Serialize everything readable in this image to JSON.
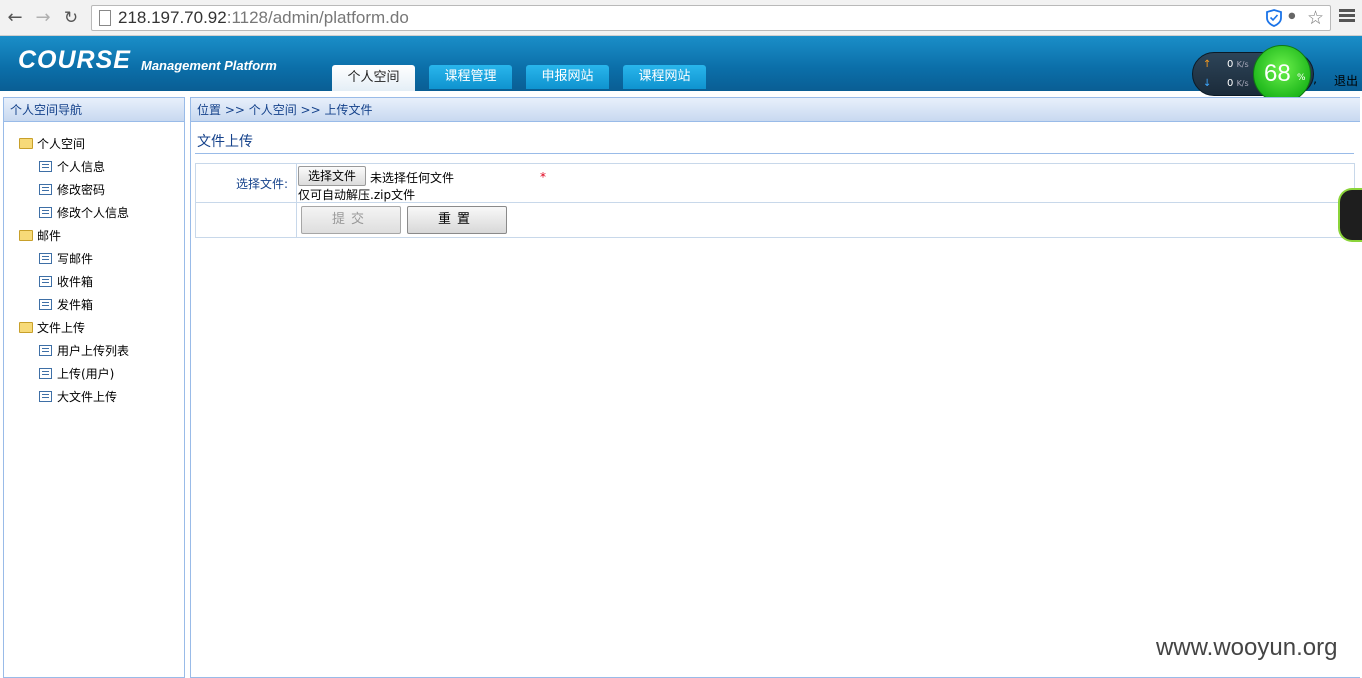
{
  "browser": {
    "url_host": "218.197.70.92",
    "url_path": ":1128/admin/platform.do"
  },
  "header": {
    "logo_main": "COURSE",
    "logo_sub": "Management Platform",
    "tabs": [
      {
        "label": "个人空间",
        "active": true
      },
      {
        "label": "课程管理",
        "active": false
      },
      {
        "label": "申报网站",
        "active": false
      },
      {
        "label": "课程网站",
        "active": false
      }
    ],
    "user_fragment": "y,",
    "logout_label": "退出"
  },
  "speed_widget": {
    "upload": "0",
    "upload_unit": "K/s",
    "download": "0",
    "download_unit": "K/s",
    "percent": "68",
    "percent_sign": "%"
  },
  "sidebar": {
    "title": "个人空间导航",
    "folders": [
      {
        "label": "个人空间",
        "items": [
          "个人信息",
          "修改密码",
          "修改个人信息"
        ]
      },
      {
        "label": "邮件",
        "items": [
          "写邮件",
          "收件箱",
          "发件箱"
        ]
      },
      {
        "label": "文件上传",
        "items": [
          "用户上传列表",
          "上传(用户)",
          "大文件上传"
        ]
      }
    ]
  },
  "main": {
    "breadcrumb": "位置 >> 个人空间 >> 上传文件",
    "title": "文件上传",
    "form": {
      "file_label": "选择文件:",
      "file_button": "选择文件",
      "file_status": "未选择任何文件",
      "required_mark": "*",
      "hint": "仅可自动解压.zip文件",
      "submit_label": "提交",
      "reset_label": "重置"
    }
  },
  "watermark": "www.wooyun.org",
  "colors": {
    "header_blue": "#0b6ea8",
    "panel_border": "#99bbe8",
    "label_blue": "#15428b",
    "required_red": "#e0001b",
    "speed_green": "#1fb81c"
  }
}
